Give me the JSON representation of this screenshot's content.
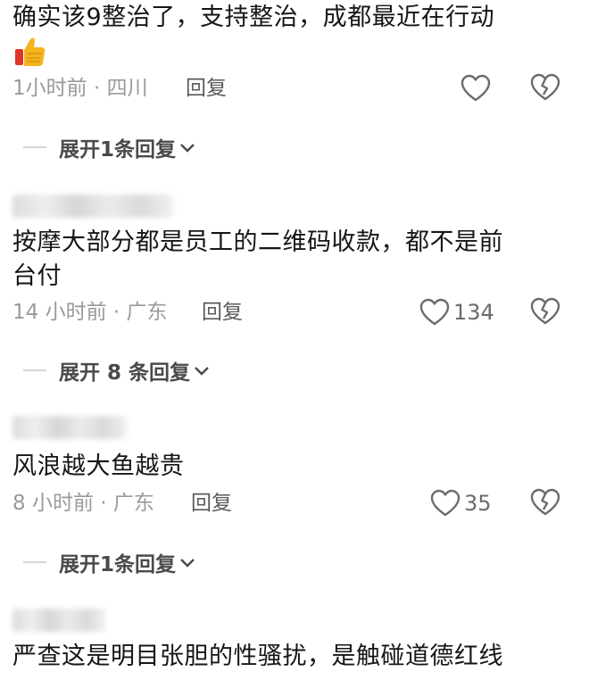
{
  "comments": [
    {
      "text": "确实该9整治了，支持整治，成都最近在行动",
      "emoji": "thumbs-up",
      "meta": "1小时前 · 四川",
      "reply_label": "回复",
      "like_count": "",
      "expand_label": "展开1条回复"
    },
    {
      "text_line1": "按摩大部分都是员工的二维码收款，都不是前",
      "text_line2": "台付",
      "meta": "14 小时前 · 广东",
      "reply_label": "回复",
      "like_count": "134",
      "expand_label": "展开 8 条回复"
    },
    {
      "text": "风浪越大鱼越贵",
      "meta": "8 小时前 · 广东",
      "reply_label": "回复",
      "like_count": "35",
      "expand_label": "展开1条回复"
    },
    {
      "text": "严查这是明目张胆的性骚扰，是触碰道德红线"
    }
  ]
}
